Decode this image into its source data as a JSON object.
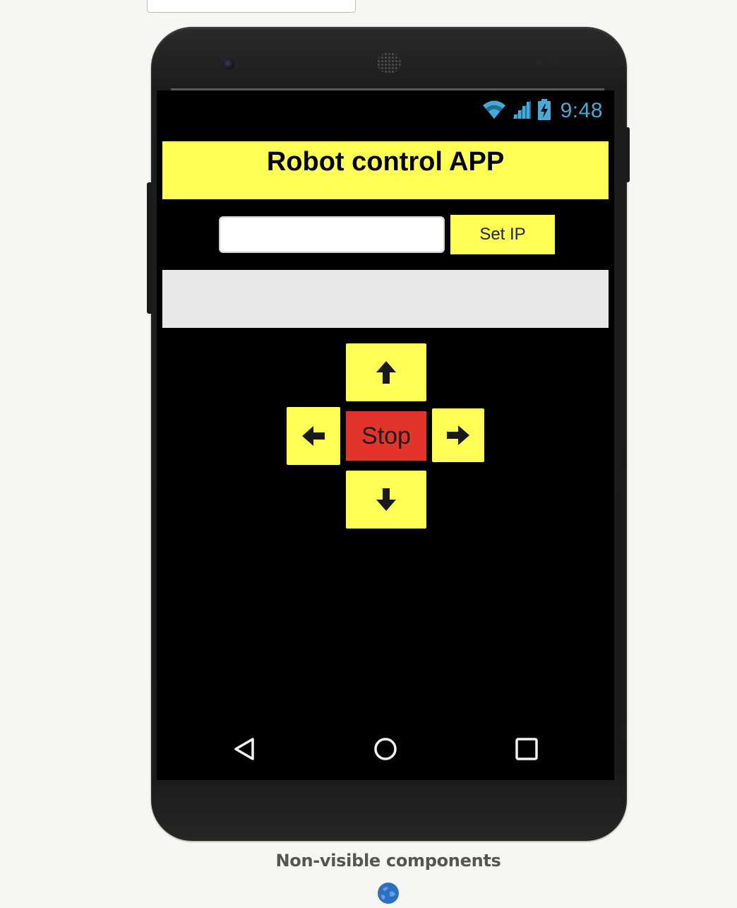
{
  "status_bar": {
    "time": "9:48",
    "icon_color": "#48a9d6",
    "icons": [
      "wifi-icon",
      "cell-signal-icon",
      "battery-charging-icon"
    ]
  },
  "app": {
    "title": "Robot control APP",
    "accent_color": "#ffff55",
    "stop_color": "#e3342b",
    "ip_input": {
      "value": "",
      "placeholder": ""
    },
    "set_ip_label": "Set IP",
    "status_text": "",
    "controls": {
      "up_icon": "arrow-up-icon",
      "left_icon": "arrow-left-icon",
      "right_icon": "arrow-right-icon",
      "down_icon": "arrow-down-icon",
      "stop_label": "Stop"
    }
  },
  "nav_bar": {
    "icons": [
      "back-icon",
      "home-icon",
      "recents-icon"
    ]
  },
  "designer": {
    "non_visible_label": "Non-visible components",
    "components": [
      "web-component-icon"
    ]
  }
}
